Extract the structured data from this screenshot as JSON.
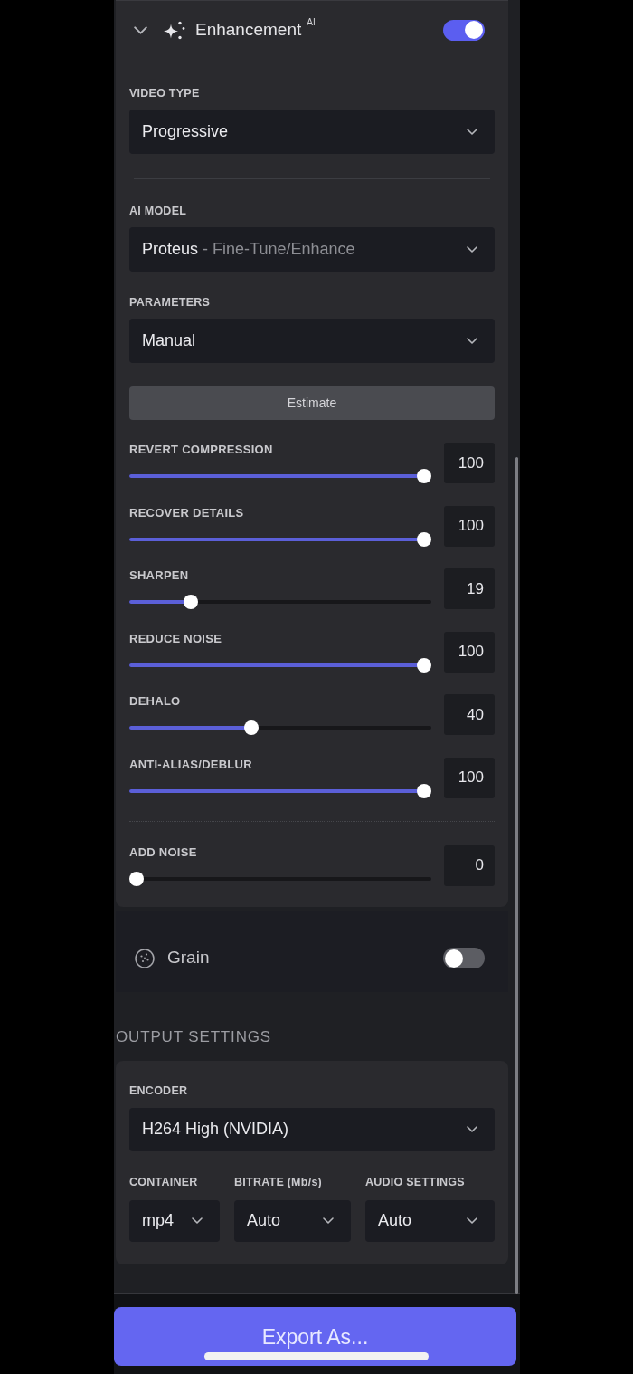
{
  "enhancement": {
    "title": "Enhancement",
    "badge": "AI",
    "expanded": true,
    "on": true,
    "field_groups": [
      [
        {
          "label": "VIDEO TYPE",
          "value": "Progressive"
        }
      ],
      [
        {
          "label": "AI MODEL",
          "value": "Proteus",
          "detail": "- Fine-Tune/Enhance"
        },
        {
          "label": "PARAMETERS",
          "value": "Manual"
        }
      ]
    ],
    "estimate_button": "Estimate",
    "sliders": [
      {
        "label": "REVERT COMPRESSION",
        "level": 1,
        "reading": "100"
      },
      {
        "label": "RECOVER DETAILS",
        "level": 1,
        "reading": "100"
      },
      {
        "label": "SHARPEN",
        "level": 0.19,
        "reading": "19"
      },
      {
        "label": "REDUCE NOISE",
        "level": 1,
        "reading": "100"
      },
      {
        "label": "DEHALO",
        "level": 0.4,
        "reading": "40"
      },
      {
        "label": "ANTI-ALIAS/DEBLUR",
        "level": 1,
        "reading": "100"
      }
    ],
    "extra_sliders": [
      {
        "label": "ADD NOISE",
        "level": 0,
        "reading": "0"
      }
    ]
  },
  "grain": {
    "title": "Grain",
    "on": false
  },
  "output_settings": {
    "title": "OUTPUT SETTINGS",
    "encoder": {
      "label": "ENCODER",
      "value": "H264 High (NVIDIA)"
    },
    "options": [
      {
        "label": "CONTAINER",
        "value": "mp4"
      },
      {
        "label": "BITRATE (Mb/s)",
        "value": "Auto"
      },
      {
        "label": "AUDIO SETTINGS",
        "value": "Auto"
      }
    ]
  },
  "export_button": "Export As..."
}
